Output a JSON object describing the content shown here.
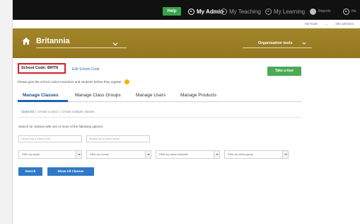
{
  "topbar": {
    "help_label": "Help",
    "nav": [
      {
        "label": "My Admin",
        "icon": "my-admin-icon"
      },
      {
        "label": "My Teaching",
        "icon": "my-teaching-icon"
      },
      {
        "label": "My Learning",
        "icon": "my-learning-icon"
      },
      {
        "label": "Reports",
        "icon": "reports-icon"
      },
      {
        "label": "No",
        "icon": "notifications-icon"
      }
    ]
  },
  "account": {
    "my_node": "My Node",
    "site_admin": "Site administ"
  },
  "banner": {
    "org_name": "Britannia",
    "org_tools": "Organisation tools",
    "color": "#9c7f25"
  },
  "school": {
    "code_label": "School Code: BRTN",
    "edit_link": "Edit School Code",
    "tour_button": "Take a tour",
    "hint": "Please give the school code to teachers and students before they register."
  },
  "tabs": [
    {
      "label": "Manage Classes",
      "active": true
    },
    {
      "label": "Manage Class Groups",
      "active": false
    },
    {
      "label": "Manage Users",
      "active": false
    },
    {
      "label": "Manage Products",
      "active": false
    }
  ],
  "sub_links": [
    "Class list",
    "Create a class",
    "Create multiple classes"
  ],
  "search": {
    "caption": "Search for classes with one or more of the following options:",
    "code_placeholder": "Search by a class code",
    "name_placeholder": "Search by a class name",
    "filters": [
      "Filter by years",
      "Filter by course",
      "Filter by class template",
      "Filter by class group"
    ],
    "search_button": "Search",
    "show_all_button": "Show All Classes"
  },
  "colors": {
    "accent_blue": "#2f79c7",
    "green": "#4aaa55",
    "highlight_red": "#d81f2a"
  }
}
